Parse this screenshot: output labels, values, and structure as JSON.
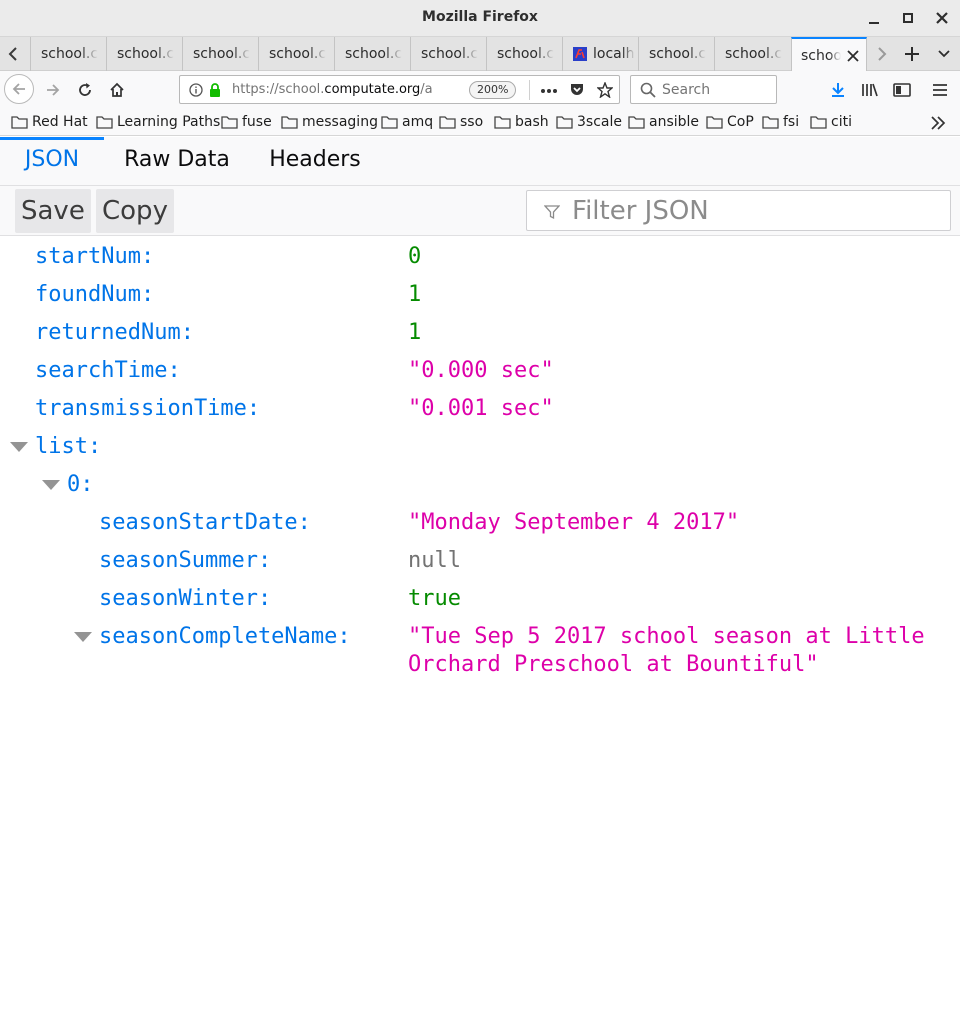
{
  "window": {
    "title": "Mozilla Firefox"
  },
  "tabs": [
    {
      "label": "school.c"
    },
    {
      "label": "school.c"
    },
    {
      "label": "school.c"
    },
    {
      "label": "school.c"
    },
    {
      "label": "school.c"
    },
    {
      "label": "school.c"
    },
    {
      "label": "school.c"
    },
    {
      "label": "localh"
    },
    {
      "label": "school.c"
    },
    {
      "label": "school.c"
    },
    {
      "label": "schoo"
    }
  ],
  "navbar": {
    "url_host": "https://school.",
    "url_domain": "computate.org",
    "url_path": "/a",
    "zoom": "200%",
    "search_placeholder": "Search"
  },
  "bookmarks": [
    {
      "label": "Red Hat"
    },
    {
      "label": "Learning Paths"
    },
    {
      "label": "fuse"
    },
    {
      "label": "messaging"
    },
    {
      "label": "amq"
    },
    {
      "label": "sso"
    },
    {
      "label": "bash"
    },
    {
      "label": "3scale"
    },
    {
      "label": "ansible"
    },
    {
      "label": "CoP"
    },
    {
      "label": "fsi"
    },
    {
      "label": "citi"
    }
  ],
  "viewer": {
    "tabs": [
      "JSON",
      "Raw Data",
      "Headers"
    ],
    "save_label": "Save",
    "copy_label": "Copy",
    "filter_placeholder": "Filter JSON"
  },
  "json": {
    "startNum": {
      "key": "startNum:",
      "value": "0"
    },
    "foundNum": {
      "key": "foundNum:",
      "value": "1"
    },
    "returnedNum": {
      "key": "returnedNum:",
      "value": "1"
    },
    "searchTime": {
      "key": "searchTime:",
      "value": "\"0.000 sec\""
    },
    "transmissionTime": {
      "key": "transmissionTime:",
      "value": "\"0.001 sec\""
    },
    "list": {
      "key": "list:"
    },
    "item0": {
      "key": "0:"
    },
    "seasonStartDate": {
      "key": "seasonStartDate:",
      "value": "\"Monday September 4 2017\""
    },
    "seasonSummer": {
      "key": "seasonSummer:",
      "value": "null"
    },
    "seasonWinter": {
      "key": "seasonWinter:",
      "value": "true"
    },
    "seasonCompleteName": {
      "key": "seasonCompleteName:",
      "value_line1": "\"Tue Sep 5 2017 school season at Little",
      "value_line2": "Orchard Preschool at Bountiful\""
    }
  },
  "colors": {
    "key": "#0074e8",
    "number": "#058b00",
    "string": "#dd00a9",
    "null": "#737373",
    "accent": "#0a84ff"
  }
}
